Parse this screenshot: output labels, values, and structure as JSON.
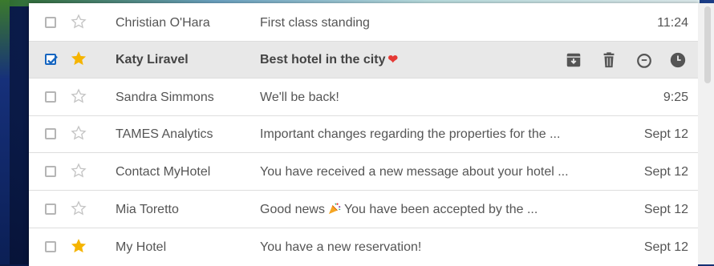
{
  "emails": [
    {
      "sender": "Christian O'Hara",
      "subject": "First class standing",
      "time": "11:24",
      "checked": false,
      "starred": false,
      "selected": false
    },
    {
      "sender": "Katy Liravel",
      "subject": "Best hotel in the city",
      "time": "",
      "checked": true,
      "starred": true,
      "selected": true,
      "subject_emoji": "heart"
    },
    {
      "sender": "Sandra Simmons",
      "subject": "We'll be back!",
      "time": "9:25",
      "checked": false,
      "starred": false,
      "selected": false
    },
    {
      "sender": "TAMES Analytics",
      "subject": "Important changes regarding the properties for the ...",
      "time": "Sept 12",
      "checked": false,
      "starred": false,
      "selected": false
    },
    {
      "sender": "Contact MyHotel",
      "subject": "You have received a new message about your hotel ...",
      "time": "Sept 12",
      "checked": false,
      "starred": false,
      "selected": false
    },
    {
      "sender": "Mia Toretto",
      "subject_before": "Good news",
      "subject_after": "You have been accepted by the ...",
      "time": "Sept 12",
      "checked": false,
      "starred": false,
      "selected": false,
      "subject_emoji": "party-popper"
    },
    {
      "sender": "My Hotel",
      "subject": "You have a new reservation!",
      "time": "Sept 12",
      "checked": false,
      "starred": true,
      "selected": false
    }
  ],
  "row_actions": [
    "archive-icon",
    "delete-icon",
    "snooze-icon",
    "schedule-icon"
  ],
  "colors": {
    "star_active": "#f5b400",
    "star_inactive": "#c4c4c4",
    "checkbox_checked": "#1565c0",
    "selected_row_bg": "#e8e8e8",
    "text": "#555555",
    "action_icon": "#555555"
  }
}
